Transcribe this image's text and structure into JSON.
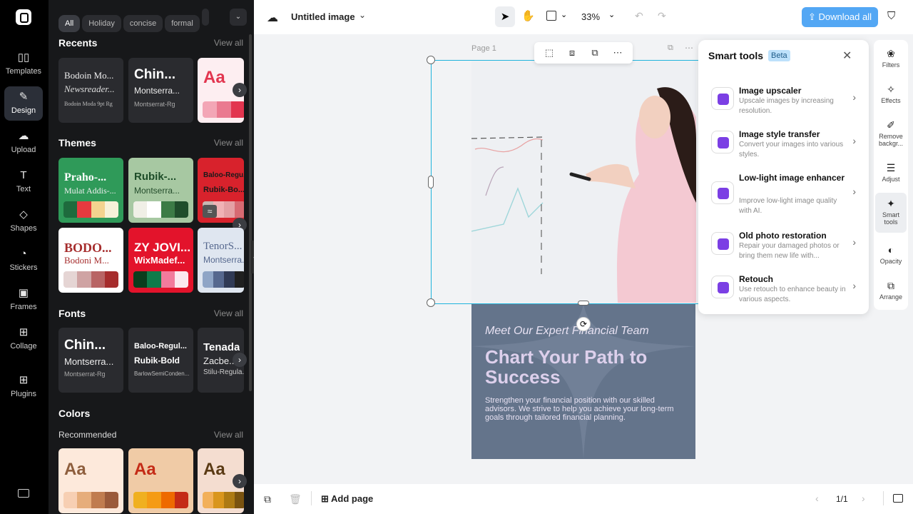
{
  "nav_rail": {
    "items": [
      {
        "label": "Templates",
        "icon": "templates-icon"
      },
      {
        "label": "Design",
        "icon": "design-icon",
        "active": true
      },
      {
        "label": "Upload",
        "icon": "upload-icon"
      },
      {
        "label": "Text",
        "icon": "text-icon"
      },
      {
        "label": "Shapes",
        "icon": "shapes-icon"
      },
      {
        "label": "Stickers",
        "icon": "stickers-icon"
      },
      {
        "label": "Frames",
        "icon": "frames-icon"
      },
      {
        "label": "Collage",
        "icon": "collage-icon"
      },
      {
        "label": "Plugins",
        "icon": "plugins-icon"
      }
    ]
  },
  "design_panel": {
    "chips": [
      "All",
      "Holiday",
      "concise",
      "formal"
    ],
    "recents": {
      "title": "Recents",
      "view_all": "View all",
      "cards": [
        {
          "line1": "Bodoin Mo...",
          "line2": "Newsreader...",
          "line3": "Bodoin Moda 9pt Rg"
        },
        {
          "line1": "Chin...",
          "line2": "Montserra...",
          "line3": "Montserrat-Rg"
        },
        {
          "line1": "Aa"
        }
      ]
    },
    "themes": {
      "title": "Themes",
      "view_all": "View all",
      "cards": [
        {
          "line1": "Praho-...",
          "line2": "Mulat Addis-...",
          "colors": [
            "#1e6b3d",
            "#e63a3f",
            "#f3d38f",
            "#f6f1d9"
          ]
        },
        {
          "line1": "Rubik-...",
          "line2": "Montserra...",
          "colors": [
            "#f0efe6",
            "#ffffff",
            "#3c7b46",
            "#1f4d2b"
          ]
        },
        {
          "line1": "Baloo-Regu...",
          "line2": "Rubik-Bo...",
          "colors": [
            "#c9b7b2",
            "#f0b2b5",
            "#e4a0a4",
            "#d76a72"
          ]
        },
        {
          "line1": "BODO...",
          "line2": "Bodoni M...",
          "colors": [
            "#e5d5d4",
            "#cfa3a3",
            "#b86464",
            "#a62d2d"
          ]
        },
        {
          "line1": "ZY JOVI...",
          "line2": "WixMadef...",
          "colors": [
            "#0b3d1d",
            "#0f7b4a",
            "#f27a9c",
            "#fbe8ef"
          ]
        },
        {
          "line1": "TenorS...",
          "line2": "Montserra...",
          "colors": [
            "#8fa5c6",
            "#56688e",
            "#303a55",
            "#202020"
          ]
        }
      ]
    },
    "fonts": {
      "title": "Fonts",
      "view_all": "View all",
      "cards": [
        {
          "line1": "Chin...",
          "line2": "Montserra...",
          "line3": "Montserrat-Rg"
        },
        {
          "line1": "Baloo-Regul...",
          "line2": "Rubik-Bold",
          "line3": "BarlowSemiConden..."
        },
        {
          "line1": "Tenada",
          "line2": "Zacbe...",
          "line3": "Stilu-Regula..."
        }
      ]
    },
    "colors": {
      "title": "Colors",
      "recommended_label": "Recommended",
      "view_all": "View all",
      "cards": [
        {
          "sample": "Aa",
          "bg": "#fde9db",
          "text_color": "#8e5e3d",
          "colors": [
            "#f7cfb3",
            "#e6ad7b",
            "#c07c4f",
            "#9a5a3a"
          ]
        },
        {
          "sample": "Aa",
          "bg": "#f0cba6",
          "text_color": "#c42b16",
          "colors": [
            "#f0b020",
            "#f59b15",
            "#ee6a00",
            "#c42b16"
          ]
        },
        {
          "sample": "Aa",
          "bg": "#f4ddd0",
          "text_color": "#5a3a14",
          "colors": [
            "#f2b05a",
            "#d9961e",
            "#ad7a14",
            "#7a5310"
          ]
        }
      ]
    }
  },
  "topbar": {
    "doc_title": "Untitled image",
    "zoom": "33%",
    "download_label": "Download all"
  },
  "canvas": {
    "page_label": "Page 1",
    "design": {
      "kicker": "Meet Our Expert Financial Team",
      "headline": "Chart Your Path to Success",
      "body": "Strengthen your financial position with our skilled advisors. We strive to help you achieve your long-term goals through tailored financial planning."
    }
  },
  "smart_tools": {
    "title": "Smart tools",
    "badge": "Beta",
    "tools": [
      {
        "title": "Image upscaler",
        "desc": "Upscale images by increasing resolution."
      },
      {
        "title": "Image style transfer",
        "desc": "Convert your images into various styles."
      },
      {
        "title": "Low-light image enhancer",
        "desc": "Improve low-light image quality with AI."
      },
      {
        "title": "Old photo restoration",
        "desc": "Repair your damaged photos or bring them new life with..."
      },
      {
        "title": "Retouch",
        "desc": "Use retouch to enhance beauty in various aspects."
      }
    ]
  },
  "right_tools": [
    {
      "label": "Filters"
    },
    {
      "label": "Effects"
    },
    {
      "label": "Remove backgr..."
    },
    {
      "label": "Adjust"
    },
    {
      "label": "Smart tools",
      "active": true
    },
    {
      "label": "Opacity"
    },
    {
      "label": "Arrange"
    }
  ],
  "bottombar": {
    "add_page": "Add page",
    "page_count": "1/1"
  }
}
